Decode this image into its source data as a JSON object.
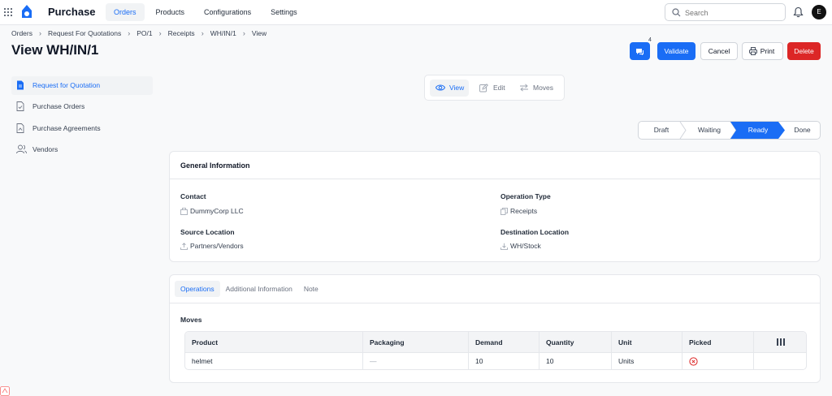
{
  "app": {
    "title": "Purchase"
  },
  "nav": [
    "Orders",
    "Products",
    "Configurations",
    "Settings"
  ],
  "search": {
    "placeholder": "Search"
  },
  "user": {
    "initial": "E"
  },
  "breadcrumb": [
    "Orders",
    "Request For Quotations",
    "PO/1",
    "Receipts",
    "WH/IN/1",
    "View"
  ],
  "page_title": "View WH/IN/1",
  "actions": {
    "chat_count": "4",
    "validate": "Validate",
    "cancel": "Cancel",
    "print": "Print",
    "delete": "Delete"
  },
  "sidebar": [
    {
      "label": "Request for Quotation",
      "icon": "document-icon"
    },
    {
      "label": "Purchase Orders",
      "icon": "document-check-icon"
    },
    {
      "label": "Purchase Agreements",
      "icon": "document-sign-icon"
    },
    {
      "label": "Vendors",
      "icon": "users-icon"
    }
  ],
  "modes": [
    "View",
    "Edit",
    "Moves"
  ],
  "stages": [
    "Draft",
    "Waiting",
    "Ready",
    "Done"
  ],
  "active_stage": "Ready",
  "general": {
    "title": "General Information",
    "contact_label": "Contact",
    "contact_value": "DummyCorp LLC",
    "operation_type_label": "Operation Type",
    "operation_type_value": "Receipts",
    "source_label": "Source Location",
    "source_value": "Partners/Vendors",
    "destination_label": "Destination Location",
    "destination_value": "WH/Stock"
  },
  "tabs": [
    "Operations",
    "Additional Information",
    "Note"
  ],
  "moves": {
    "title": "Moves",
    "columns": [
      "Product",
      "Packaging",
      "Demand",
      "Quantity",
      "Unit",
      "Picked"
    ],
    "rows": [
      {
        "product": "helmet",
        "packaging": "—",
        "demand": "10",
        "quantity": "10",
        "unit": "Units"
      }
    ]
  },
  "colors": {
    "accent": "#1a6df5",
    "danger": "#dc2626"
  }
}
